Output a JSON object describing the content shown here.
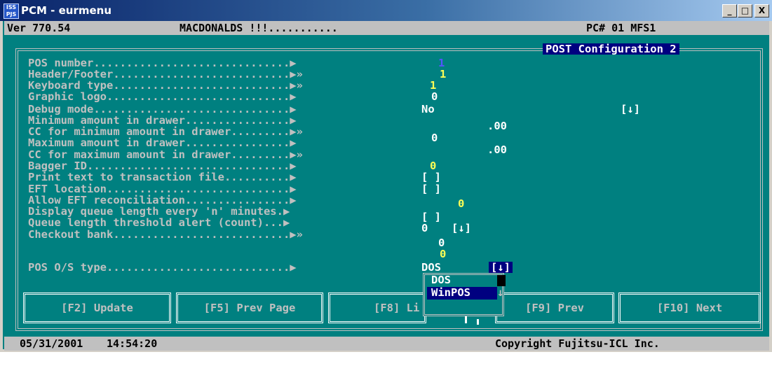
{
  "window": {
    "title": "PCM - eurmenu",
    "icon_text": "ISS\nPJS",
    "buttons": {
      "minimize": "_",
      "maximize": "□",
      "close": "X"
    }
  },
  "header": {
    "version": "Ver 770.54",
    "store": "MACDONALDS !!!...........",
    "pc": "PC# 01 MFS1"
  },
  "panel_title": "POST Configuration 2",
  "fields": [
    {
      "label": "POS number..............................▶",
      "value": "1"
    },
    {
      "label": "Header/Footer...........................▶»",
      "value": "1"
    },
    {
      "label": "Keyboard type...........................▶»",
      "value": "1"
    },
    {
      "label": "Graphic logo............................▶",
      "value": "0"
    },
    {
      "label": "Debug mode..............................▶",
      "value": "No",
      "extra": "[↓]"
    },
    {
      "label": "Minimum amount in drawer................▶",
      "value": ".00"
    },
    {
      "label": "CC for minimum amount in drawer.........▶»",
      "value": "0"
    },
    {
      "label": "Maximum amount in drawer................▶",
      "value": ".00"
    },
    {
      "label": "CC for maximum amount in drawer.........▶»",
      "value": "0"
    },
    {
      "label": "Bagger ID...............................▶",
      "value": "[ ]"
    },
    {
      "label": "Print text to transaction file..........▶",
      "value": "[ ]"
    },
    {
      "label": "EFT location............................▶",
      "value": "0"
    },
    {
      "label": "Allow EFT reconciliation................▶",
      "value": "[ ]"
    },
    {
      "label": "Display queue length every 'n' minutes.▶",
      "value": "0",
      "extra": "[↓]"
    },
    {
      "label": "Queue length threshold alert (count)...▶",
      "value": "0"
    },
    {
      "label": "Checkout bank...........................▶»",
      "value": "0"
    },
    {
      "label": "POS O/S type............................▶",
      "value": "DOS",
      "extra": "[↓]"
    }
  ],
  "dropdown": {
    "options": [
      "DOS",
      "WinPOS"
    ],
    "selected": "WinPOS",
    "scroll_arrow": "↓"
  },
  "fkeys": [
    {
      "label": "[F2] Update"
    },
    {
      "label": "[F5] Prev Page"
    },
    {
      "label": "[F8] Li"
    },
    {
      "label": "[F9] Prev"
    },
    {
      "label": "[F10] Next"
    }
  ],
  "footer": {
    "date": "05/31/2001",
    "time": "14:54:20",
    "copyright": "Copyright Fujitsu-ICL Inc."
  }
}
